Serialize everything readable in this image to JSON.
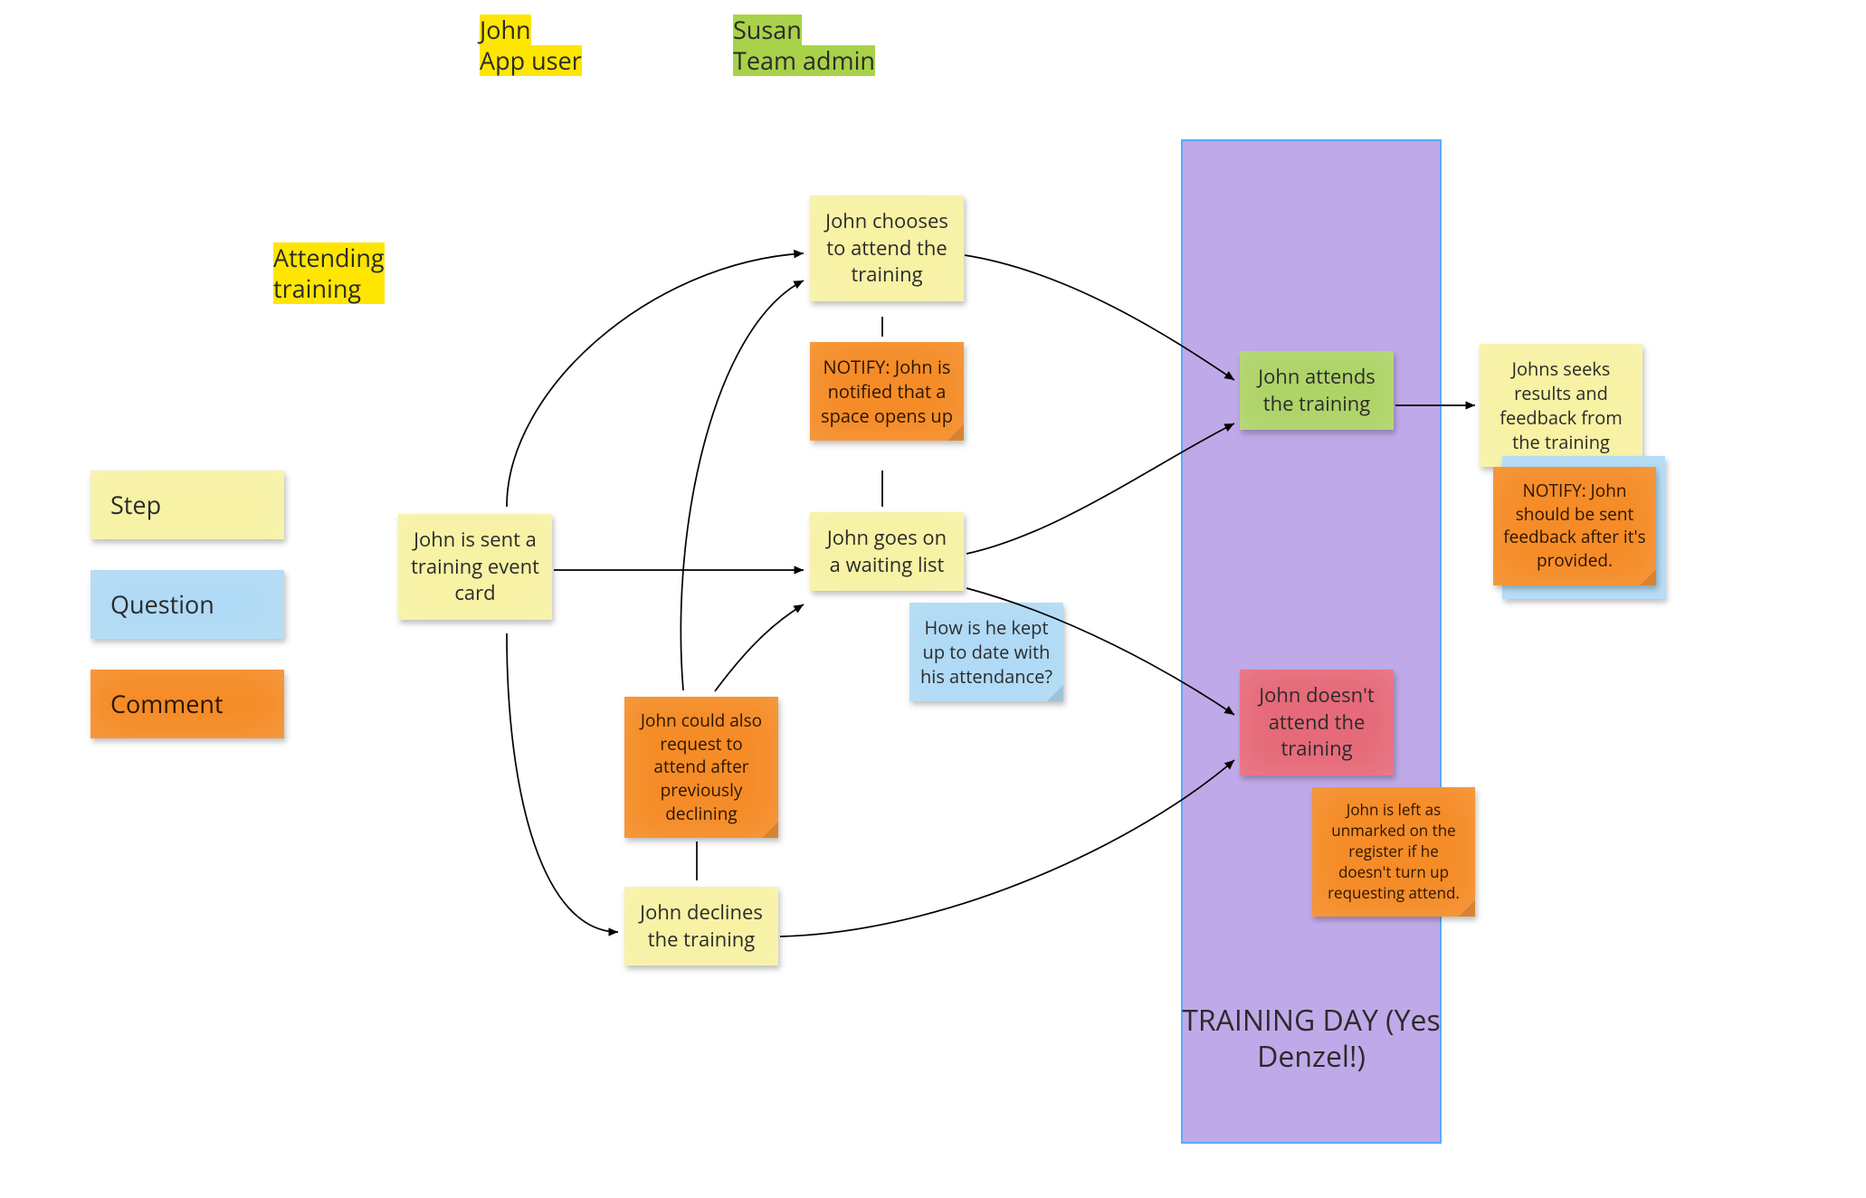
{
  "personas": {
    "john_line1": "John",
    "john_line2": "App user",
    "susan_line1": "Susan",
    "susan_line2": "Team admin"
  },
  "section_label": "Attending\ntraining",
  "legend": {
    "step": "Step",
    "question": "Question",
    "comment": "Comment"
  },
  "nodes": {
    "sent_card": "John is sent a training event card",
    "chooses_attend": "John chooses to attend the training",
    "notify_space": "NOTIFY: John is notified that a space opens up",
    "waiting_list": "John goes on a waiting list",
    "kept_up_to_date": "How is he kept up to date with his attendance?",
    "request_after_decline": "John could also request to attend after previously declining",
    "declines": "John declines the training",
    "attends": "John attends the training",
    "doesnt_attend": "John doesn't attend the training",
    "seeks_feedback": "Johns seeks results and feedback from the training",
    "notify_feedback": "NOTIFY: John should be sent feedback after it's provided.",
    "left_unmarked": "John is left as unmarked on the register if he doesn't turn up requesting attend."
  },
  "band_label": "TRAINING DAY (Yes Denzel!)"
}
